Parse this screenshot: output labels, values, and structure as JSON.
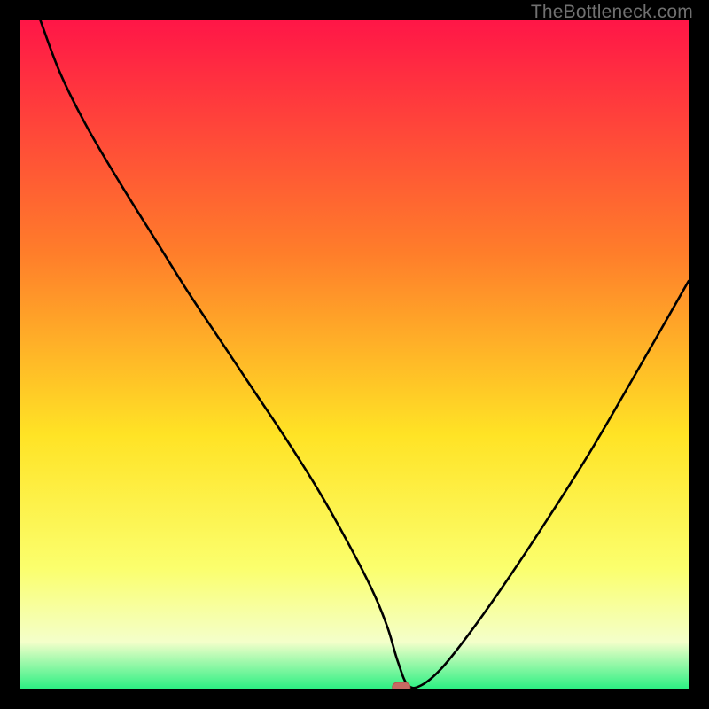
{
  "watermark": "TheBottleneck.com",
  "colors": {
    "frame": "#000000",
    "grad_top": "#ff1647",
    "grad_mid1": "#ff7e2a",
    "grad_mid2": "#ffe325",
    "grad_mid3": "#fbff6d",
    "grad_mid4": "#f4ffca",
    "grad_bottom": "#2df083",
    "curve": "#000000",
    "marker_fill": "#c76a63",
    "marker_stroke": "#b5554e"
  },
  "chart_data": {
    "type": "line",
    "title": "",
    "xlabel": "",
    "ylabel": "",
    "xlim": [
      0,
      100
    ],
    "ylim": [
      0,
      100
    ],
    "series": [
      {
        "name": "bottleneck-curve",
        "x": [
          3,
          6,
          10,
          15,
          20,
          25,
          30,
          35,
          40,
          45,
          50,
          53,
          55,
          56.5,
          58,
          60,
          63,
          67,
          72,
          78,
          85,
          92,
          100
        ],
        "y": [
          100,
          92,
          84,
          75.5,
          67.5,
          59.5,
          52,
          44.5,
          37,
          29,
          20,
          14,
          9,
          4,
          0.5,
          0.5,
          3,
          8,
          15,
          24,
          35,
          47,
          61
        ]
      }
    ],
    "marker": {
      "x": 57,
      "y": 0.2
    },
    "annotations": []
  }
}
